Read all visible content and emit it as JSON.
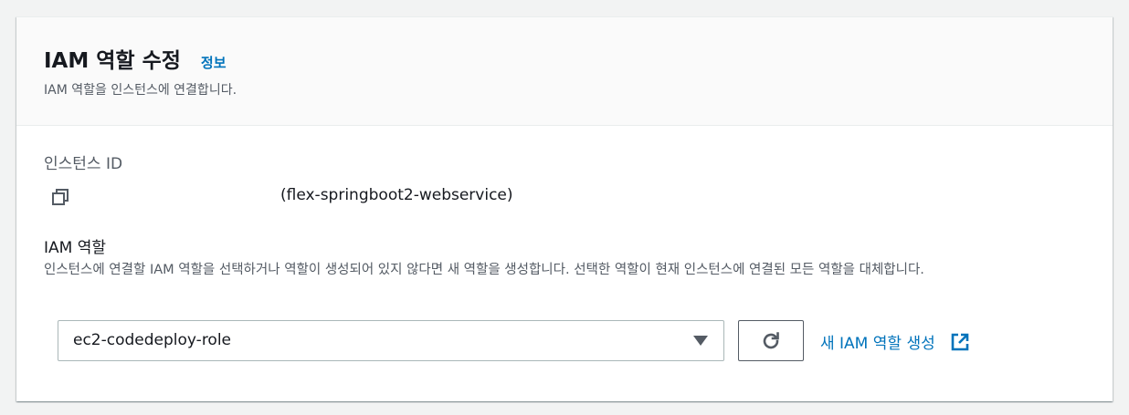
{
  "header": {
    "title": "IAM 역할 수정",
    "info_link": "정보",
    "description": "IAM 역할을 인스턴스에 연결합니다."
  },
  "instance": {
    "label": "인스턴스 ID",
    "name": "(flex-springboot2-webservice)",
    "copy_icon": "copy-icon"
  },
  "iam_role": {
    "label": "IAM 역할",
    "description": "인스턴스에 연결할 IAM 역할을 선택하거나 역할이 생성되어 있지 않다면 새 역할을 생성합니다. 선택한 역할이 현재 인스턴스에 연결된 모든 역할을 대체합니다.",
    "selected_value": "ec2-codedeploy-role",
    "refresh_icon": "refresh-icon",
    "create_link": "새 IAM 역할 생성",
    "external_icon": "external-link-icon"
  },
  "colors": {
    "link": "#0073bb",
    "text": "#16191f",
    "secondary_text": "#545b64",
    "header_bg": "#fafafa",
    "page_bg": "#f2f3f3"
  }
}
